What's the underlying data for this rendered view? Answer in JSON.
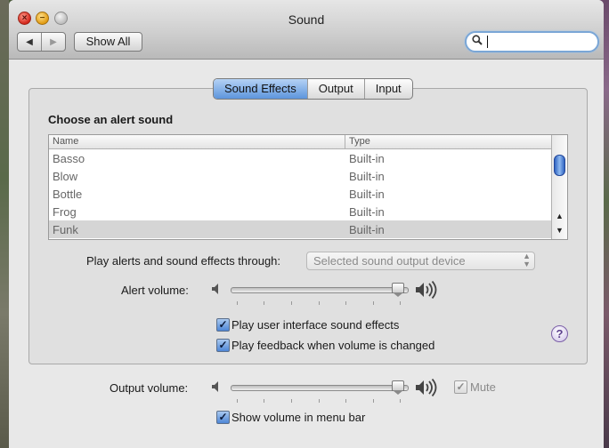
{
  "window": {
    "title": "Sound",
    "nav_back": "◀",
    "nav_forward": "▶",
    "show_all": "Show All",
    "search": {
      "value": "",
      "placeholder": ""
    }
  },
  "tabs": [
    {
      "label": "Sound Effects",
      "active": true
    },
    {
      "label": "Output",
      "active": false
    },
    {
      "label": "Input",
      "active": false
    }
  ],
  "sound_effects": {
    "heading": "Choose an alert sound",
    "columns": [
      "Name",
      "Type"
    ],
    "rows": [
      {
        "name": "Basso",
        "type": "Built-in"
      },
      {
        "name": "Blow",
        "type": "Built-in"
      },
      {
        "name": "Bottle",
        "type": "Built-in"
      },
      {
        "name": "Frog",
        "type": "Built-in"
      },
      {
        "name": "Funk",
        "type": "Built-in",
        "selected": true
      }
    ],
    "play_through_label": "Play alerts and sound effects through:",
    "play_through_value": "Selected sound output device",
    "alert_volume_label": "Alert volume:",
    "alert_volume": 0.95,
    "ui_sounds": {
      "label": "Play user interface sound effects",
      "checked": true
    },
    "feedback": {
      "label": "Play feedback when volume is changed",
      "checked": true
    },
    "help": "?"
  },
  "output": {
    "volume_label": "Output volume:",
    "volume": 0.95,
    "mute": {
      "label": "Mute",
      "checked": true,
      "enabled": false
    },
    "menu_bar": {
      "label": "Show volume in menu bar",
      "checked": true
    }
  },
  "icons": {
    "check": "✓",
    "speaker_low": "speaker-low-icon",
    "speaker_high": "speaker-high-icon",
    "search": "magnifier-icon"
  },
  "colors": {
    "accent": "#5d95dc",
    "help": "#5b3f8c"
  }
}
